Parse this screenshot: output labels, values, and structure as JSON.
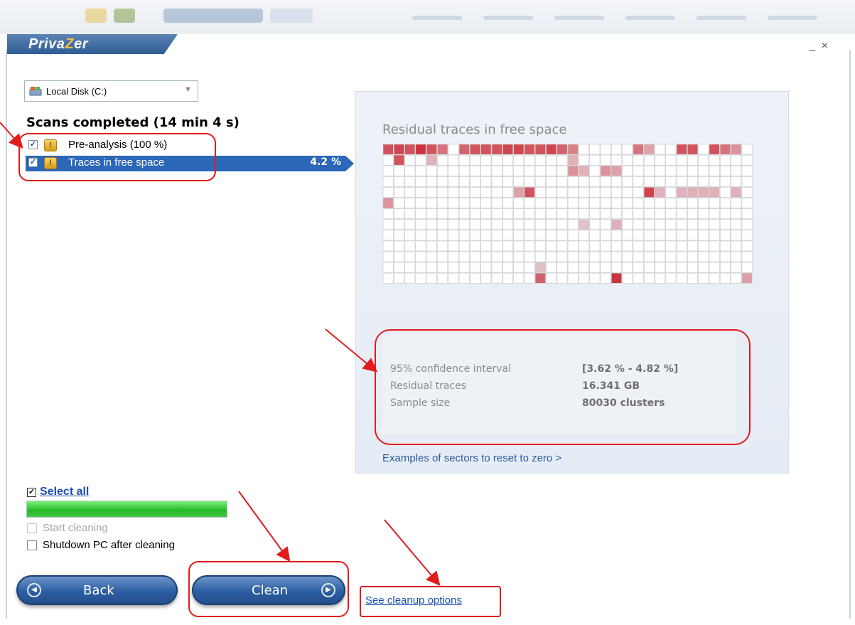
{
  "app": {
    "title_part1": "Priva",
    "title_part2": "Z",
    "title_part3": "er",
    "window_controls": "_ ×"
  },
  "drive_select": {
    "value": "Local Disk (C:)",
    "icon": "disk-icon"
  },
  "scans": {
    "title": "Scans completed (14 min 4 s)",
    "items": [
      {
        "label": "Pre-analysis (100 %)",
        "checked": true,
        "selected": false,
        "percent": ""
      },
      {
        "label": "Traces in free space",
        "checked": true,
        "selected": true,
        "percent": "4.2 %"
      }
    ]
  },
  "panel": {
    "title": "Residual traces in free space",
    "stats": [
      {
        "label": "95% confidence interval",
        "value": "[3.62 % - 4.82 %]"
      },
      {
        "label": "Residual traces",
        "value": "16.341 GB"
      },
      {
        "label": "Sample size",
        "value": "80030 clusters"
      }
    ],
    "examples_link": "Examples of sectors to reset to zero >"
  },
  "select_all": {
    "label": "Select all",
    "checked": true
  },
  "progress": {
    "fraction": 1.0
  },
  "options": {
    "start_cleaning": "Start cleaning",
    "shutdown": "Shutdown PC after cleaning"
  },
  "buttons": {
    "back": "Back",
    "clean": "Clean"
  },
  "cleanup_link": "See cleanup options",
  "colors": {
    "accent": "#2c67b8",
    "annotation": "#e21b1b",
    "progress": "#22b925"
  }
}
